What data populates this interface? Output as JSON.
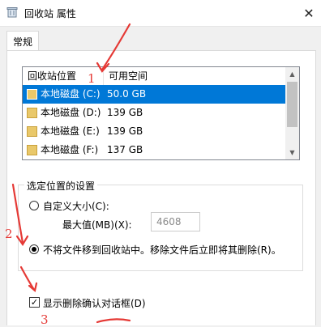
{
  "window": {
    "title": "回收站 属性",
    "close_glyph": "✕",
    "icon": "recycle-bin-icon"
  },
  "tabs": [
    {
      "label": "常规",
      "active": true
    }
  ],
  "list": {
    "headers": {
      "location": "回收站位置",
      "space": "可用空间"
    },
    "rows": [
      {
        "name": "本地磁盘 (C:)",
        "space": "50.0 GB",
        "selected": true
      },
      {
        "name": "本地磁盘 (D:)",
        "space": "139 GB",
        "selected": false
      },
      {
        "name": "本地磁盘 (E:)",
        "space": "139 GB",
        "selected": false
      },
      {
        "name": "本地磁盘 (F:)",
        "space": "137 GB",
        "selected": false
      }
    ]
  },
  "settings": {
    "group_label": "选定位置的设置",
    "custom_size_label": "自定义大小(C):",
    "max_size_label": "最大值(MB)(X):",
    "max_size_value": "4608",
    "delete_immediately_label": "不将文件移到回收站中。移除文件后立即将其删除(R)。",
    "custom_selected": false,
    "delete_immediately_selected": true
  },
  "confirm": {
    "label": "显示删除确认对话框(D)",
    "checked": true,
    "check_glyph": "✓"
  },
  "annotations": {
    "one": "1",
    "two": "2",
    "three": "3",
    "color": "#e53935"
  }
}
